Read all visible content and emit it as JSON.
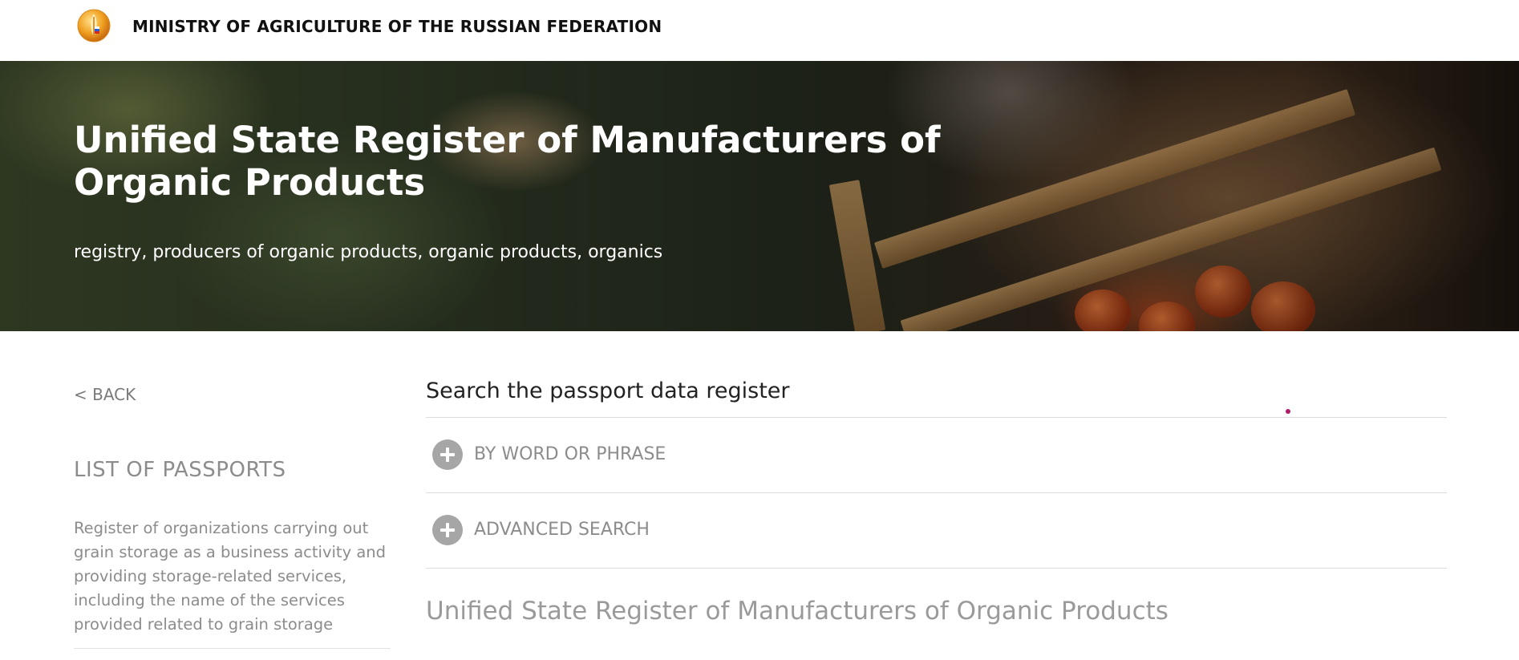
{
  "header": {
    "ministry_name": "MINISTRY OF AGRICULTURE OF THE RUSSIAN FEDERATION",
    "logo_icon": "wheat-emblem-icon"
  },
  "hero": {
    "title": "Unified State Register of Manufacturers of Organic Products",
    "tags": "registry, producers of organic products, organic products, organics"
  },
  "sidebar": {
    "back_label": "< BACK",
    "section_title": "LIST OF PASSPORTS",
    "description": "Register of organizations carrying out grain storage as a business activity and providing storage-related services, including the name of the services provided related to grain storage"
  },
  "main": {
    "search_title": "Search the passport data register",
    "accordions": [
      {
        "label": "BY WORD OR PHRASE",
        "icon": "plus-circle-icon"
      },
      {
        "label": "ADVANCED SEARCH",
        "icon": "plus-circle-icon"
      }
    ],
    "registry_title": "Unified State Register of Manufacturers of Organic Products"
  },
  "colors": {
    "accent_dot": "#b21a6a",
    "icon_gray": "#a6a6a6",
    "text_gray": "#8c8c8c"
  }
}
